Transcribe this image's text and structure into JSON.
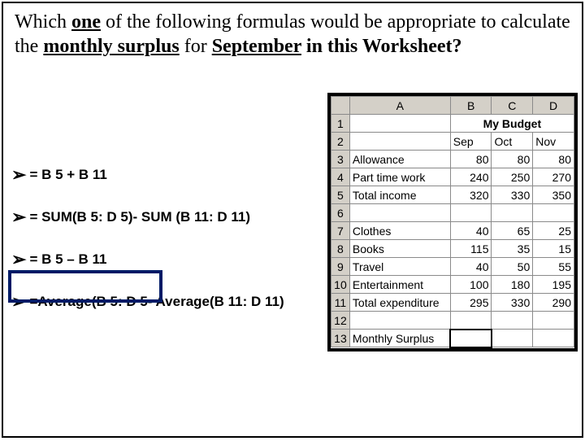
{
  "question": {
    "prefix": "Which ",
    "one": "one",
    "mid1": " of the following formulas would be appropriate to calculate the ",
    "monthly_surplus": "monthly surplus",
    "mid2": " for ",
    "september": "September",
    "suffix": " in this Worksheet?"
  },
  "options": {
    "a": "= B 5 + B 11",
    "b": "= SUM(B 5: D 5)- SUM (B 11: D 11)",
    "c": "= B 5 – B 11",
    "d": "=Average(B 5: D 5- Average(B 11: D 11)"
  },
  "chart_data": {
    "type": "table",
    "title": "My Budget",
    "columns": [
      "A",
      "B",
      "C",
      "D"
    ],
    "month_headers": [
      "Sep",
      "Oct",
      "Nov"
    ],
    "rows": [
      {
        "n": 1,
        "label": "",
        "b": "My Budget",
        "c": "",
        "d": ""
      },
      {
        "n": 2,
        "label": "",
        "b": "Sep",
        "c": "Oct",
        "d": "Nov"
      },
      {
        "n": 3,
        "label": "Allowance",
        "b": 80,
        "c": 80,
        "d": 80
      },
      {
        "n": 4,
        "label": "Part time work",
        "b": 240,
        "c": 250,
        "d": 270
      },
      {
        "n": 5,
        "label": "Total income",
        "b": 320,
        "c": 330,
        "d": 350
      },
      {
        "n": 6,
        "label": "",
        "b": "",
        "c": "",
        "d": ""
      },
      {
        "n": 7,
        "label": "Clothes",
        "b": 40,
        "c": 65,
        "d": 25
      },
      {
        "n": 8,
        "label": "Books",
        "b": 115,
        "c": 35,
        "d": 15
      },
      {
        "n": 9,
        "label": "Travel",
        "b": 40,
        "c": 50,
        "d": 55
      },
      {
        "n": 10,
        "label": "Entertainment",
        "b": 100,
        "c": 180,
        "d": 195
      },
      {
        "n": 11,
        "label": "Total expenditure",
        "b": 295,
        "c": 330,
        "d": 290
      },
      {
        "n": 12,
        "label": "",
        "b": "",
        "c": "",
        "d": ""
      },
      {
        "n": 13,
        "label": "Monthly Surplus",
        "b": "",
        "c": "",
        "d": ""
      }
    ],
    "selected_cell": "B13"
  }
}
